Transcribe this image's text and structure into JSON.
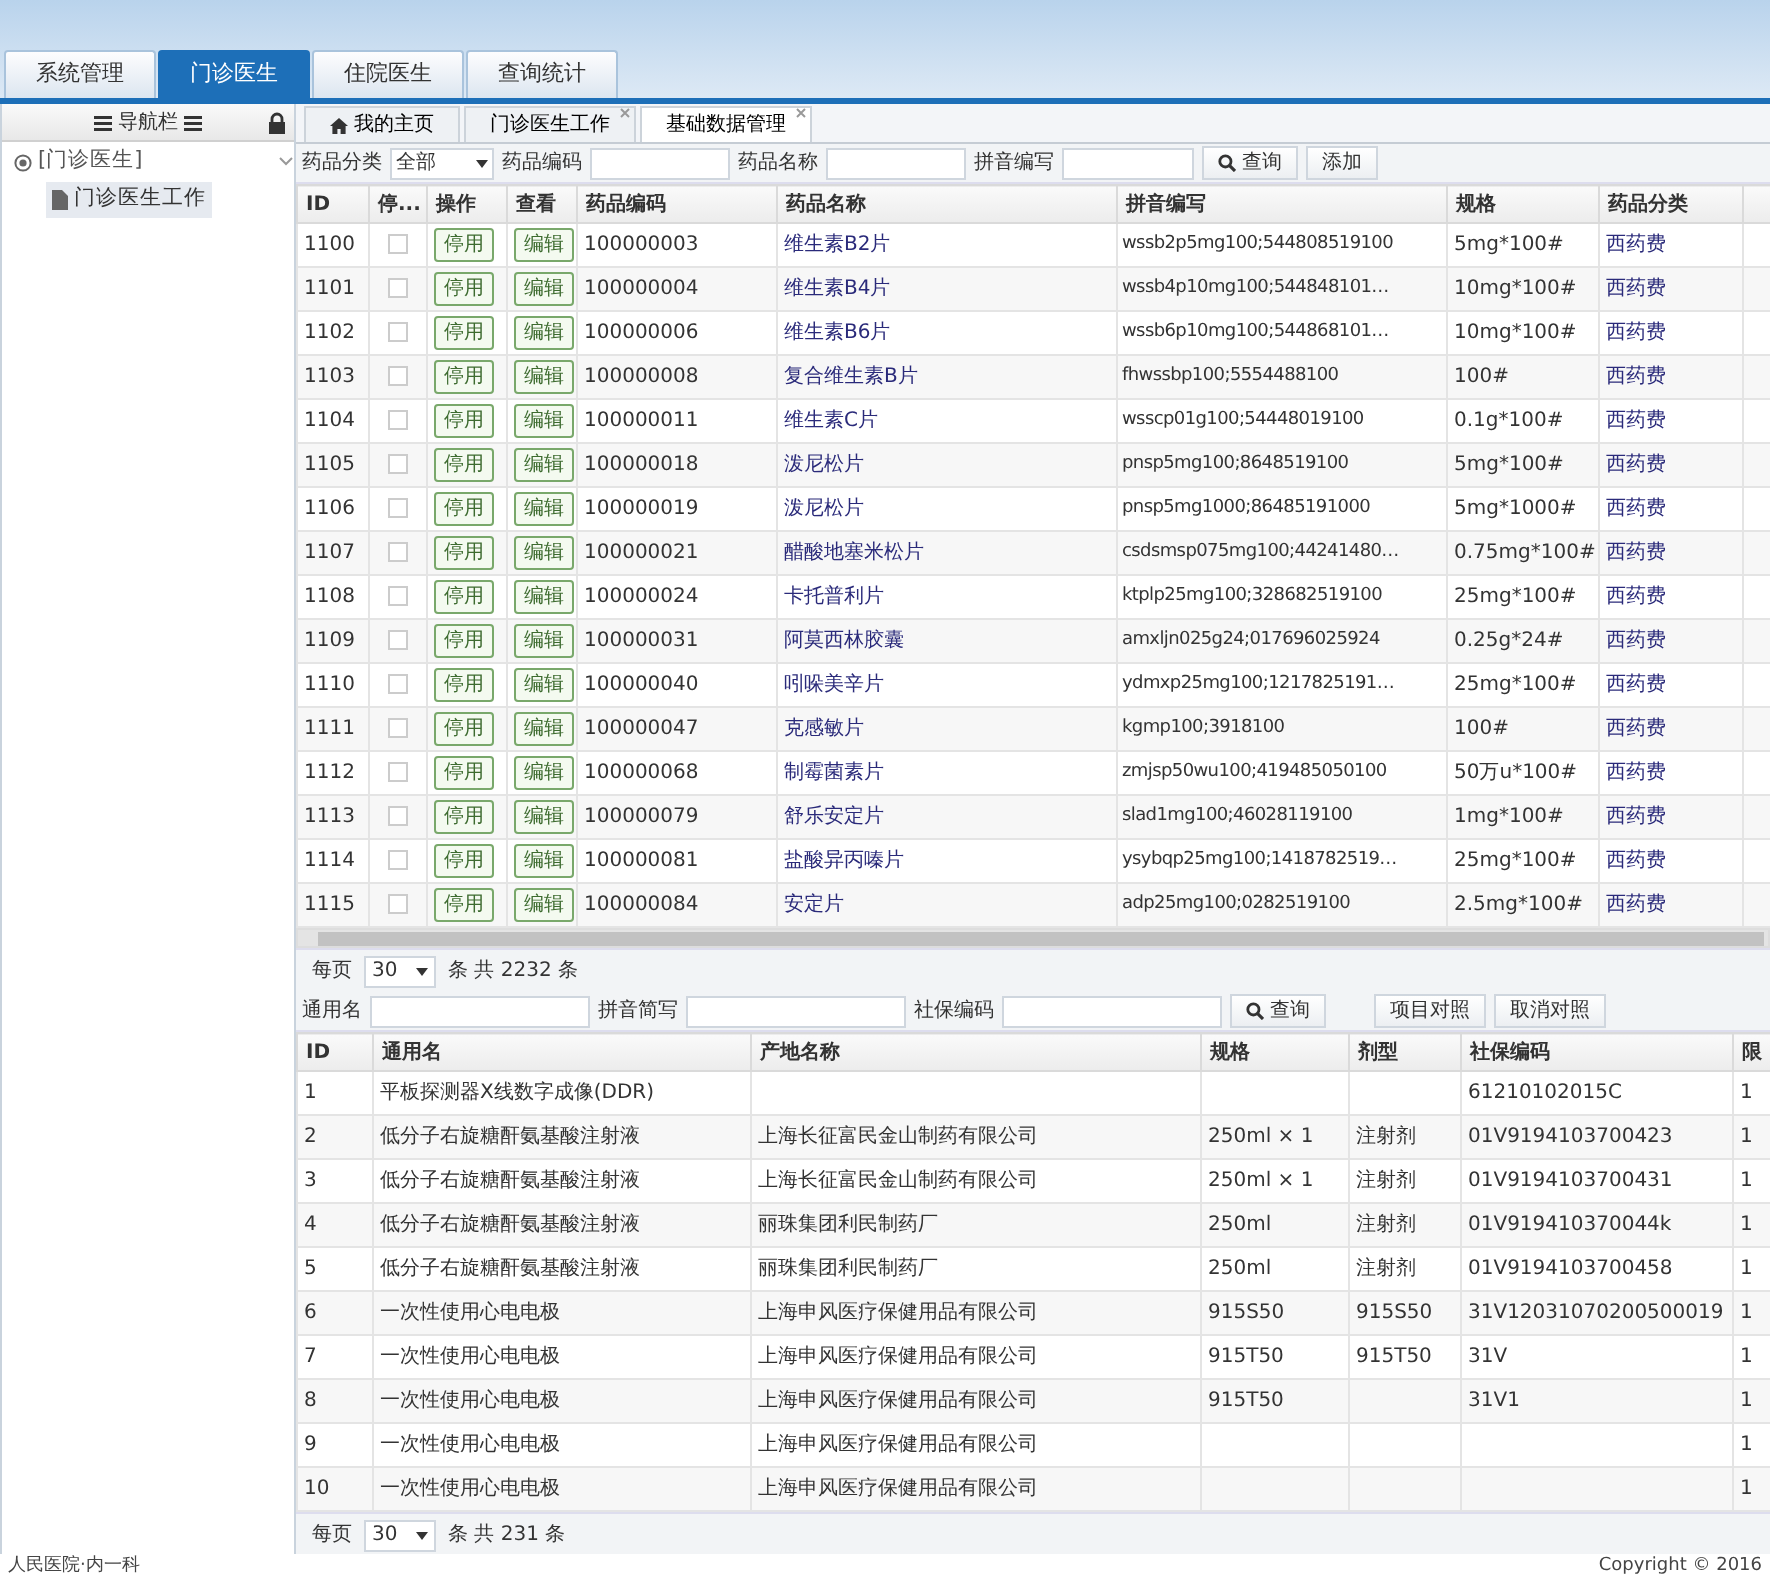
{
  "top_tabs": [
    {
      "label": "系统管理",
      "selected": false
    },
    {
      "label": "门诊医生",
      "selected": true
    },
    {
      "label": "住院医生",
      "selected": false
    },
    {
      "label": "查询统计",
      "selected": false
    }
  ],
  "sidebar": {
    "title": "导航栏",
    "tree": [
      {
        "label": "[门诊医生]",
        "expanded": true,
        "children": [
          {
            "label": "门诊医生工作",
            "selected": true
          }
        ]
      }
    ]
  },
  "page_tabs": [
    {
      "label": "我的主页",
      "kind": "home",
      "selected": false
    },
    {
      "label": "门诊医生工作",
      "kind": "closable",
      "selected": false
    },
    {
      "label": "基础数据管理",
      "kind": "closable",
      "selected": true
    }
  ],
  "drug_filter": {
    "fields": [
      {
        "label": "药品分类",
        "kind": "select",
        "value": "全部"
      },
      {
        "label": "药品编码",
        "kind": "input"
      },
      {
        "label": "药品名称",
        "kind": "input"
      },
      {
        "label": "拼音编写",
        "kind": "input"
      }
    ],
    "buttons": [
      {
        "label": "查询",
        "kind": "search"
      },
      {
        "label": "添加",
        "kind": "plain"
      }
    ]
  },
  "drug_table": {
    "columns": [
      "ID",
      "停...",
      "操作",
      "查看",
      "药品编码",
      "药品名称",
      "拼音编写",
      "规格",
      "药品分类"
    ],
    "rows": [
      {
        "id": "1100",
        "checked": false,
        "action": "停用",
        "view": "编辑",
        "code": "100000003",
        "name": "维生素B2片",
        "pinyin": "wssb2p5mg100;544808519100",
        "spec": "5mg*100#",
        "category": "西药费"
      },
      {
        "id": "1101",
        "checked": false,
        "action": "停用",
        "view": "编辑",
        "code": "100000004",
        "name": "维生素B4片",
        "pinyin": "wssb4p10mg100;544848101…",
        "spec": "10mg*100#",
        "category": "西药费"
      },
      {
        "id": "1102",
        "checked": false,
        "action": "停用",
        "view": "编辑",
        "code": "100000006",
        "name": "维生素B6片",
        "pinyin": "wssb6p10mg100;544868101…",
        "spec": "10mg*100#",
        "category": "西药费"
      },
      {
        "id": "1103",
        "checked": false,
        "action": "停用",
        "view": "编辑",
        "code": "100000008",
        "name": "复合维生素B片",
        "pinyin": "fhwssbp100;5554488100",
        "spec": "100#",
        "category": "西药费"
      },
      {
        "id": "1104",
        "checked": false,
        "action": "停用",
        "view": "编辑",
        "code": "100000011",
        "name": "维生素C片",
        "pinyin": "wsscp01g100;54448019100",
        "spec": "0.1g*100#",
        "category": "西药费"
      },
      {
        "id": "1105",
        "checked": false,
        "action": "停用",
        "view": "编辑",
        "code": "100000018",
        "name": "泼尼松片",
        "pinyin": "pnsp5mg100;8648519100",
        "spec": "5mg*100#",
        "category": "西药费"
      },
      {
        "id": "1106",
        "checked": false,
        "action": "停用",
        "view": "编辑",
        "code": "100000019",
        "name": "泼尼松片",
        "pinyin": "pnsp5mg1000;86485191000",
        "spec": "5mg*1000#",
        "category": "西药费"
      },
      {
        "id": "1107",
        "checked": false,
        "action": "停用",
        "view": "编辑",
        "code": "100000021",
        "name": "醋酸地塞米松片",
        "pinyin": "csdsmsp075mg100;44241480…",
        "spec": "0.75mg*100#",
        "category": "西药费"
      },
      {
        "id": "1108",
        "checked": false,
        "action": "停用",
        "view": "编辑",
        "code": "100000024",
        "name": "卡托普利片",
        "pinyin": "ktplp25mg100;328682519100",
        "spec": "25mg*100#",
        "category": "西药费"
      },
      {
        "id": "1109",
        "checked": false,
        "action": "停用",
        "view": "编辑",
        "code": "100000031",
        "name": "阿莫西林胶囊",
        "pinyin": "amxljn025g24;017696025924",
        "spec": "0.25g*24#",
        "category": "西药费"
      },
      {
        "id": "1110",
        "checked": false,
        "action": "停用",
        "view": "编辑",
        "code": "100000040",
        "name": "吲哚美辛片",
        "pinyin": "ydmxp25mg100;1217825191…",
        "spec": "25mg*100#",
        "category": "西药费"
      },
      {
        "id": "1111",
        "checked": false,
        "action": "停用",
        "view": "编辑",
        "code": "100000047",
        "name": "克感敏片",
        "pinyin": "kgmp100;3918100",
        "spec": "100#",
        "category": "西药费"
      },
      {
        "id": "1112",
        "checked": false,
        "action": "停用",
        "view": "编辑",
        "code": "100000068",
        "name": "制霉菌素片",
        "pinyin": "zmjsp50wu100;419485050100",
        "spec": "50万u*100#",
        "category": "西药费"
      },
      {
        "id": "1113",
        "checked": false,
        "action": "停用",
        "view": "编辑",
        "code": "100000079",
        "name": "舒乐安定片",
        "pinyin": "slad1mg100;46028119100",
        "spec": "1mg*100#",
        "category": "西药费"
      },
      {
        "id": "1114",
        "checked": false,
        "action": "停用",
        "view": "编辑",
        "code": "100000081",
        "name": "盐酸异丙嗪片",
        "pinyin": "ysybqp25mg100;1418782519…",
        "spec": "25mg*100#",
        "category": "西药费"
      },
      {
        "id": "1115",
        "checked": false,
        "action": "停用",
        "view": "编辑",
        "code": "100000084",
        "name": "安定片",
        "pinyin": "adp25mg100;0282519100",
        "spec": "2.5mg*100#",
        "category": "西药费"
      }
    ]
  },
  "drug_pager": {
    "label": "每页",
    "page_size": "30",
    "summary": "条 共 2232 条"
  },
  "insurance_filter": {
    "fields": [
      {
        "label": "通用名",
        "kind": "input"
      },
      {
        "label": "拼音简写",
        "kind": "input"
      },
      {
        "label": "社保编码",
        "kind": "input"
      }
    ],
    "buttons": [
      {
        "label": "查询",
        "kind": "search"
      },
      {
        "label": "项目对照",
        "kind": "plain"
      },
      {
        "label": "取消对照",
        "kind": "plain"
      }
    ]
  },
  "insurance_table": {
    "columns": [
      "ID",
      "通用名",
      "产地名称",
      "规格",
      "剂型",
      "社保编码",
      "限"
    ],
    "rows": [
      {
        "id": "1",
        "name": "平板探测器X线数字成像(DDR)",
        "code": "61210102015C",
        "column_7": "1"
      },
      {
        "id": "2",
        "name": "低分子右旋糖酐氨基酸注射液",
        "origin": "上海长征富民金山制药有限公司",
        "spec": "250ml × 1",
        "form": "注射剂",
        "code": "01V9194103700423",
        "column_7": "1"
      },
      {
        "id": "3",
        "name": "低分子右旋糖酐氨基酸注射液",
        "origin": "上海长征富民金山制药有限公司",
        "spec": "250ml × 1",
        "form": "注射剂",
        "code": "01V9194103700431",
        "column_7": "1"
      },
      {
        "id": "4",
        "name": "低分子右旋糖酐氨基酸注射液",
        "origin": "丽珠集团利民制药厂",
        "spec": "250ml",
        "form": "注射剂",
        "code": "01V919410370044k",
        "column_7": "1"
      },
      {
        "id": "5",
        "name": "低分子右旋糖酐氨基酸注射液",
        "origin": "丽珠集团利民制药厂",
        "spec": "250ml",
        "form": "注射剂",
        "code": "01V9194103700458",
        "column_7": "1"
      },
      {
        "id": "6",
        "name": "一次性使用心电电极",
        "origin": "上海申风医疗保健用品有限公司",
        "spec": "915S50",
        "form": "915S50",
        "code": "31V12031070200500019",
        "column_7": "1"
      },
      {
        "id": "7",
        "name": "一次性使用心电电极",
        "origin": "上海申风医疗保健用品有限公司",
        "spec": "915T50",
        "form": "915T50",
        "code": "31V",
        "column_7": "1"
      },
      {
        "id": "8",
        "name": "一次性使用心电电极",
        "origin": "上海申风医疗保健用品有限公司",
        "spec": "915T50",
        "code": "31V1",
        "column_7": "1"
      },
      {
        "id": "9",
        "name": "一次性使用心电电极",
        "origin": "上海申风医疗保健用品有限公司",
        "column_7": "1"
      },
      {
        "id": "10",
        "name": "一次性使用心电电极",
        "origin": "上海申风医疗保健用品有限公司",
        "column_7": "1"
      }
    ]
  },
  "insurance_pager": {
    "label": "每页",
    "page_size": "30",
    "summary": "条 共 231 条"
  },
  "status_bar": {
    "left": "人民医院·内一科",
    "right": "Copyright © 2016"
  }
}
